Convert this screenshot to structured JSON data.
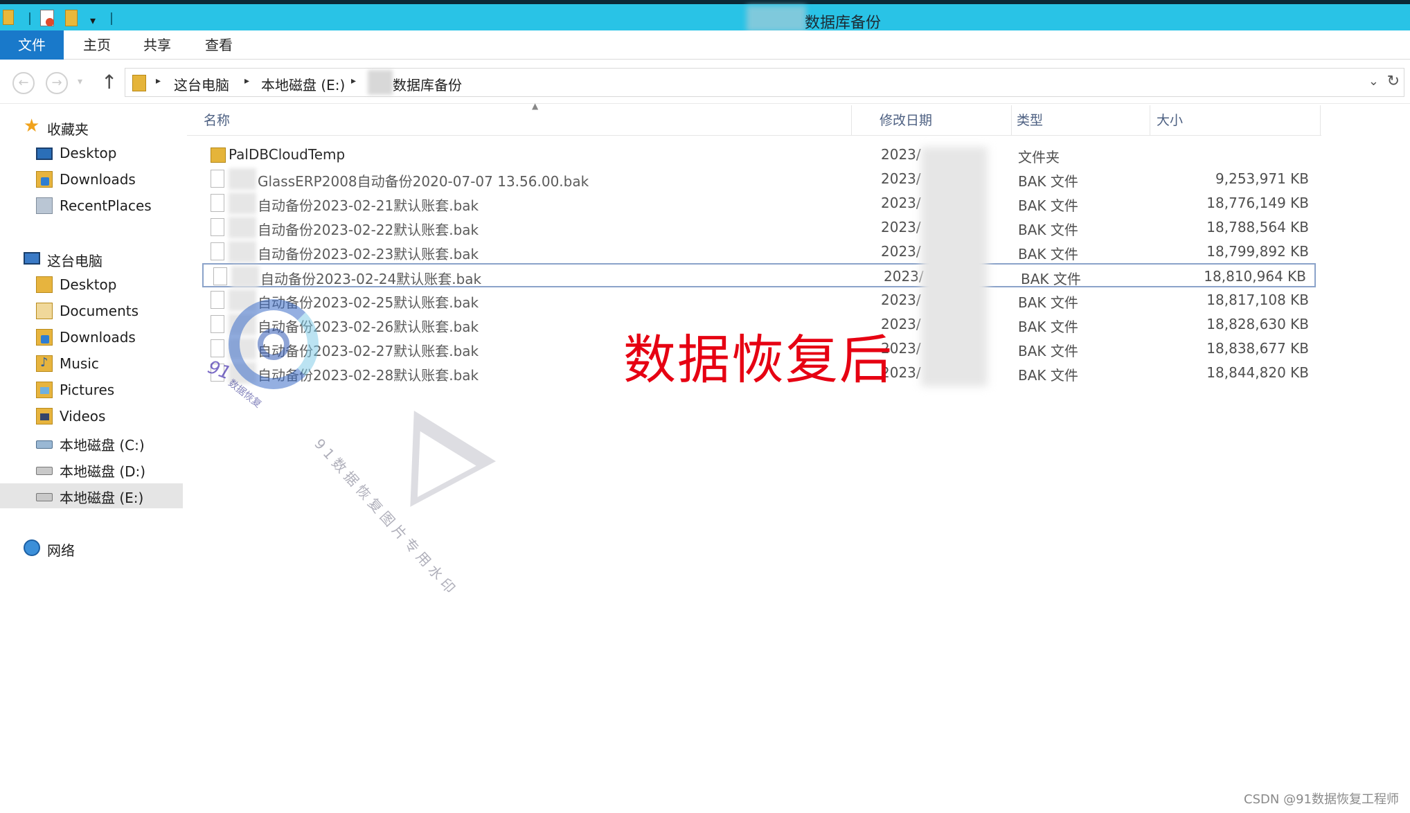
{
  "window": {
    "title": "数据库备份"
  },
  "quick_access": {
    "dropdown_glyph": "▾"
  },
  "ribbon": {
    "tabs": [
      "文件",
      "主页",
      "共享",
      "查看"
    ]
  },
  "nav": {
    "back_glyph": "←",
    "forward_glyph": "→",
    "recent_glyph": "▾",
    "up_glyph": "↑",
    "breadcrumb": [
      "这台电脑",
      "本地磁盘 (E:)",
      "数据库备份"
    ],
    "sep_glyph": "▸",
    "dropdown_glyph": "⌄",
    "refresh_glyph": "↻"
  },
  "sidebar": {
    "favorites": {
      "label": "收藏夹",
      "items": [
        "Desktop",
        "Downloads",
        "RecentPlaces"
      ]
    },
    "this_pc": {
      "label": "这台电脑",
      "items": [
        "Desktop",
        "Documents",
        "Downloads",
        "Music",
        "Pictures",
        "Videos",
        "本地磁盘 (C:)",
        "本地磁盘 (D:)",
        "本地磁盘 (E:)"
      ]
    },
    "network": {
      "label": "网络"
    },
    "selected": "本地磁盘 (E:)"
  },
  "columns": {
    "name": "名称",
    "date": "修改日期",
    "type": "类型",
    "size": "大小",
    "sort_glyph": "▲"
  },
  "files": [
    {
      "name": "PalDBCloudTemp",
      "date": "2023/",
      "type": "文件夹",
      "size": "",
      "kind": "folder"
    },
    {
      "name": "GlassERP2008自动备份2020-07-07 13.56.00.bak",
      "date": "2023/",
      "type": "BAK 文件",
      "size": "9,253,971 KB",
      "kind": "file"
    },
    {
      "name": "自动备份2023-02-21默认账套.bak",
      "date": "2023/",
      "type": "BAK 文件",
      "size": "18,776,149 KB",
      "kind": "file"
    },
    {
      "name": "自动备份2023-02-22默认账套.bak",
      "date": "2023/",
      "type": "BAK 文件",
      "size": "18,788,564 KB",
      "kind": "file"
    },
    {
      "name": "自动备份2023-02-23默认账套.bak",
      "date": "2023/",
      "type": "BAK 文件",
      "size": "18,799,892 KB",
      "kind": "file"
    },
    {
      "name": "自动备份2023-02-24默认账套.bak",
      "date": "2023/",
      "type": "BAK 文件",
      "size": "18,810,964 KB",
      "kind": "file",
      "selected": true
    },
    {
      "name": "自动备份2023-02-25默认账套.bak",
      "date": "2023/",
      "type": "BAK 文件",
      "size": "18,817,108 KB",
      "kind": "file"
    },
    {
      "name": "自动备份2023-02-26默认账套.bak",
      "date": "2023/",
      "type": "BAK 文件",
      "size": "18,828,630 KB",
      "kind": "file"
    },
    {
      "name": "自动备份2023-02-27默认账套.bak",
      "date": "2023/",
      "type": "BAK 文件",
      "size": "18,838,677 KB",
      "kind": "file"
    },
    {
      "name": "自动备份2023-02-28默认账套.bak",
      "date": "2023/",
      "type": "BAK 文件",
      "size": "18,844,820 KB",
      "kind": "file"
    }
  ],
  "overlay_caption": "数据恢复后",
  "watermark": {
    "logo_text": "91",
    "logo_sub": "数据恢复",
    "diagonal_text": "91数据恢复图片专用水印"
  },
  "credit": "CSDN @91数据恢复工程师",
  "colors": {
    "titlebar": "#29c3e6",
    "file_tab": "#1979ca",
    "caption": "#e60012",
    "header_text": "#4d6082"
  }
}
